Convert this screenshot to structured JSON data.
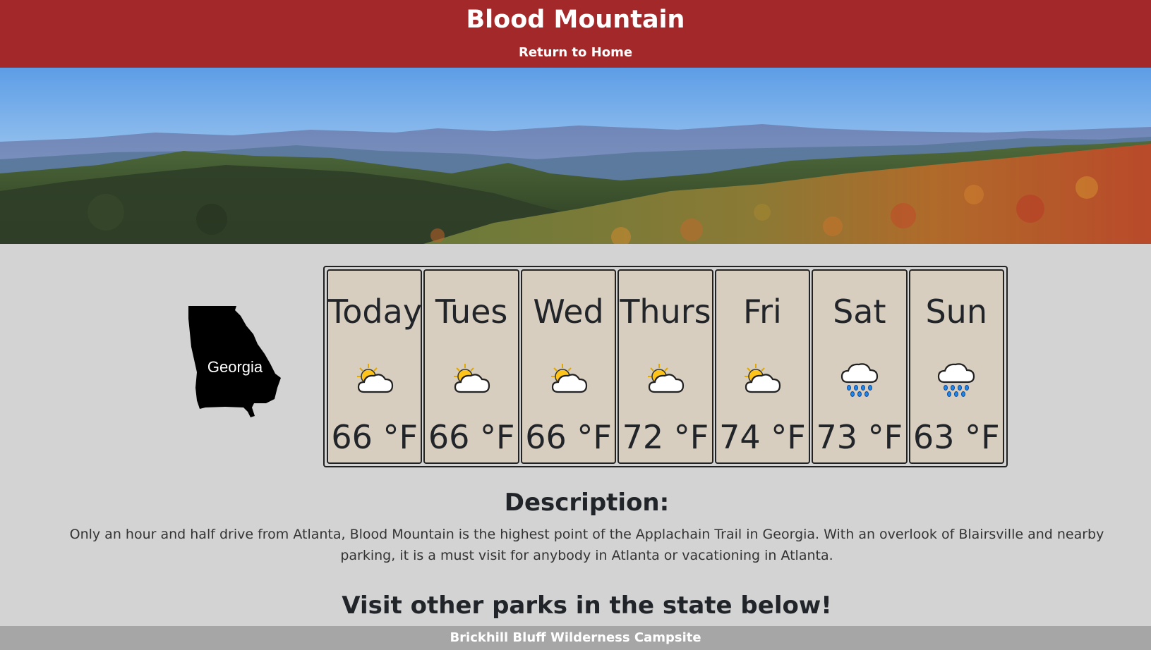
{
  "header": {
    "title": "Blood Mountain",
    "home_link": "Return to Home",
    "color": "#a3282a"
  },
  "state_map": {
    "label": "Georgia"
  },
  "forecast": [
    {
      "day": "Today",
      "icon": "partly-cloudy-icon",
      "temp": "66 °F"
    },
    {
      "day": "Tues",
      "icon": "partly-cloudy-icon",
      "temp": "66 °F"
    },
    {
      "day": "Wed",
      "icon": "partly-cloudy-icon",
      "temp": "66 °F"
    },
    {
      "day": "Thurs",
      "icon": "partly-cloudy-icon",
      "temp": "72 °F"
    },
    {
      "day": "Fri",
      "icon": "partly-cloudy-icon",
      "temp": "74 °F"
    },
    {
      "day": "Sat",
      "icon": "rain-icon",
      "temp": "73 °F"
    },
    {
      "day": "Sun",
      "icon": "rain-icon",
      "temp": "63 °F"
    }
  ],
  "description": {
    "heading": "Description:",
    "text": "Only an hour and half drive from Atlanta, Blood Mountain is the highest point of the Applachain Trail in Georgia. With an overlook of Blairsville and nearby parking, it is a must visit for anybody in Atlanta or vacationing in Atlanta."
  },
  "other_parks": {
    "heading": "Visit other parks in the state below!",
    "links": [
      "Brickhill Bluff Wilderness Campsite"
    ]
  }
}
